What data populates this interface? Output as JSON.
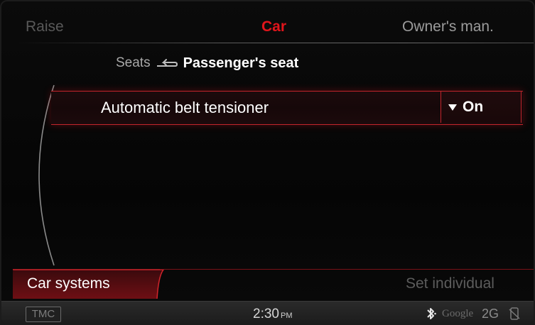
{
  "top_bar": {
    "left_item": "Raise",
    "center_item": "Car",
    "right_item": "Owner's man."
  },
  "breadcrumb": {
    "parent": "Seats",
    "current": "Passenger's seat",
    "back_icon": "return-arrow-icon"
  },
  "settings": {
    "items": [
      {
        "label": "Automatic belt tensioner",
        "value": "On",
        "control_icon": "dropdown-triangle-icon"
      }
    ]
  },
  "bottom_tabs": {
    "left": "Car systems",
    "right": "Set individual"
  },
  "status_bar": {
    "tmc": "TMC",
    "time": "2:30",
    "meridiem": "PM",
    "bluetooth_icon": "bluetooth-icon",
    "map_provider": "Google",
    "network": "2G",
    "phone_icon": "phone-icon"
  },
  "colors": {
    "accent_red": "#e0151b",
    "background": "#050505",
    "highlight_border": "#c2252c"
  }
}
